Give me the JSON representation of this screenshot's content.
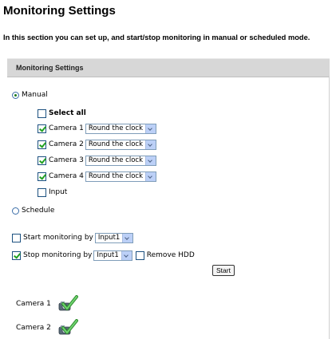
{
  "page": {
    "title": "Monitoring Settings",
    "description": "In this section you can set up, and start/stop monitoring in manual or scheduled mode.",
    "section_header": "Monitoring Settings"
  },
  "mode": {
    "manual_label": "Manual",
    "schedule_label": "Schedule",
    "selected": "Manual"
  },
  "manual": {
    "select_all_label": "Select all",
    "select_all_checked": false,
    "cameras": [
      {
        "label": "Camera 1",
        "checked": true,
        "mode": "Round the clock"
      },
      {
        "label": "Camera 2",
        "checked": true,
        "mode": "Round the clock"
      },
      {
        "label": "Camera 3",
        "checked": true,
        "mode": "Round the clock"
      },
      {
        "label": "Camera 4",
        "checked": true,
        "mode": "Round the clock"
      }
    ],
    "input_label": "Input",
    "input_checked": false
  },
  "triggers": {
    "start_label": "Start monitoring by",
    "start_checked": false,
    "start_input": "Input1",
    "stop_label": "Stop monitoring by",
    "stop_checked": true,
    "stop_input": "Input1",
    "remove_hdd_label": "Remove HDD",
    "remove_hdd_checked": false
  },
  "start_button": "Start",
  "status": [
    {
      "label": "Camera 1",
      "icon": "camera-ok-icon"
    },
    {
      "label": "Camera 2",
      "icon": "camera-ok-icon"
    }
  ],
  "colors": {
    "section_bar": "#d7d7d7",
    "check": "#21a121",
    "select_arrow_bg": "#bcd0f7"
  }
}
